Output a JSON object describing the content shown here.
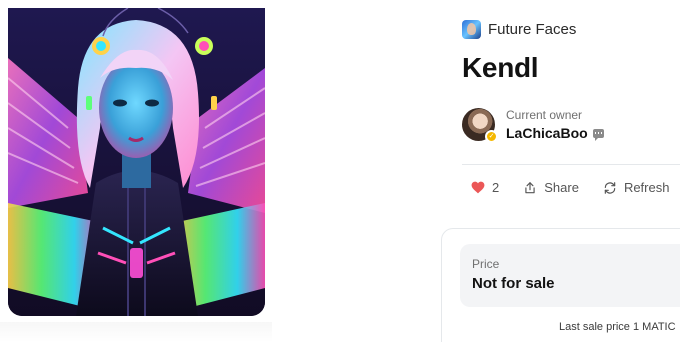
{
  "artwork": {
    "alt": "Kendl artwork",
    "colors": {
      "bg": "#1b1640",
      "cyan": "#34e6ff",
      "pink": "#ff4fb8",
      "green": "#5dff7a",
      "orange": "#ffb347",
      "hair": "#e9c7f0"
    }
  },
  "collection": {
    "name": "Future Faces",
    "icon": "collection-thumbnail"
  },
  "item": {
    "title": "Kendl"
  },
  "owner": {
    "label": "Current owner",
    "name": "LaChicaBoo",
    "badge_icon": "verified-badge-icon",
    "message_icon": "chat-icon"
  },
  "actions": {
    "favorites_count": "2",
    "share_label": "Share",
    "refresh_label": "Refresh"
  },
  "price": {
    "label": "Price",
    "value": "Not for sale",
    "last_sale": "Last sale price 1 MATIC"
  },
  "colors": {
    "accent_heart": "#eb5757",
    "verified": "#f5b800",
    "muted_text": "#707070"
  }
}
